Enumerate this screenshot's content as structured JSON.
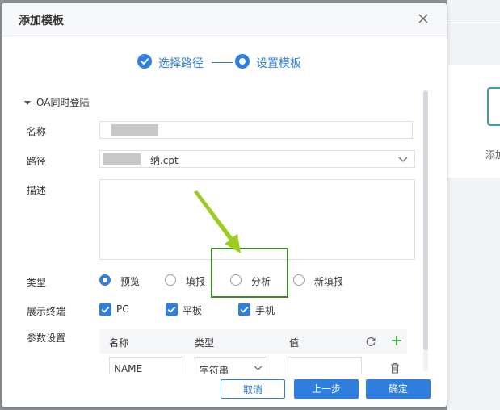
{
  "background": {
    "partial_label": "添加"
  },
  "dialog": {
    "title": "添加模板",
    "steps": [
      {
        "label": "选择路径",
        "state": "done"
      },
      {
        "label": "设置模板",
        "state": "current"
      }
    ],
    "form": {
      "group_title": "OA同时登陆",
      "name_label": "名称",
      "path_label": "路径",
      "path_value_suffix": "纳.cpt",
      "desc_label": "描述",
      "type_label": "类型",
      "type_options": [
        {
          "label": "预览",
          "checked": true
        },
        {
          "label": "填报",
          "checked": false
        },
        {
          "label": "分析",
          "checked": false
        },
        {
          "label": "新填报",
          "checked": false
        }
      ],
      "terminal_label": "展示终端",
      "terminals": [
        {
          "label": "PC",
          "checked": true
        },
        {
          "label": "平板",
          "checked": true
        },
        {
          "label": "手机",
          "checked": true
        }
      ],
      "param_label": "参数设置",
      "param_table": {
        "headers": [
          "名称",
          "类型",
          "值"
        ],
        "row": {
          "name": "NAME",
          "type": "字符串",
          "value": ""
        }
      }
    },
    "footer": {
      "cancel": "取消",
      "prev": "上一步",
      "confirm": "确定"
    }
  },
  "colors": {
    "accent": "#2f7fdf",
    "annotation_box": "#3a8a2a",
    "annotation_arrow": "#9acd1f"
  }
}
